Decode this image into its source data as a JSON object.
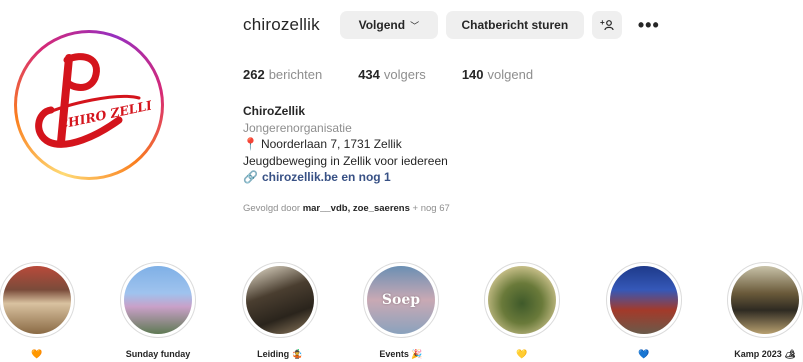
{
  "profile": {
    "username": "chirozellik",
    "logo_text": "CHIRO ZELLIK",
    "follow_button": "Volgend",
    "message_button": "Chatbericht sturen",
    "add_user_icon": "+8",
    "more_icon": "•••"
  },
  "stats": {
    "posts_count": "262",
    "posts_label": "berichten",
    "followers_count": "434",
    "followers_label": "volgers",
    "following_count": "140",
    "following_label": "volgend"
  },
  "bio": {
    "name": "ChiroZellik",
    "category": "Jongerenorganisatie",
    "address": "Noorderlaan 7, 1731 Zellik",
    "description": "Jeugdbeweging in Zellik voor iedereen",
    "link": "chirozellik.be en nog 1"
  },
  "followed_by": {
    "prefix": "Gevolgd door",
    "names": "mar__vdb, zoe_saerens",
    "suffix": "+ nog 67"
  },
  "highlights": [
    {
      "label": "🧡"
    },
    {
      "label": "Sunday funday"
    },
    {
      "label": "Leiding 🤹"
    },
    {
      "label": "Events 🎉"
    },
    {
      "label": "💛"
    },
    {
      "label": "💙"
    },
    {
      "label": "Kamp 2023 🏕"
    }
  ],
  "colors": {
    "accent_link": "#385185",
    "logo_red": "#d4141c",
    "button_bg": "#efefef"
  }
}
